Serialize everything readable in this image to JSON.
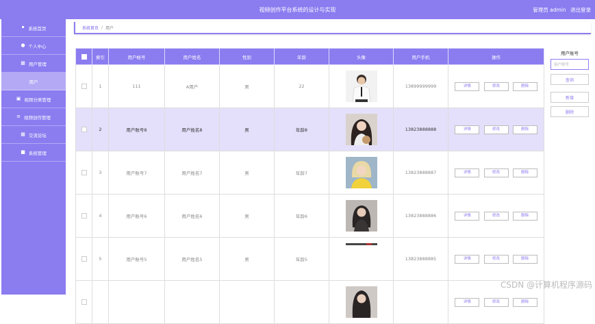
{
  "header": {
    "title": "视频创作平台系统的设计与实现",
    "user_label": "管理员 admin",
    "logout": "退出登录"
  },
  "sidebar": {
    "items": [
      {
        "label": "系统首页",
        "icon": "home-icon"
      },
      {
        "label": "个人中心",
        "icon": "user-icon"
      },
      {
        "label": "用户管理",
        "icon": "table-icon"
      },
      {
        "label": "用户",
        "icon": ""
      },
      {
        "label": "视频分类管理",
        "icon": "category-icon"
      },
      {
        "label": "视频创作管理",
        "icon": "sliders-icon"
      },
      {
        "label": "交流论坛",
        "icon": "grid-icon"
      },
      {
        "label": "系统管理",
        "icon": "settings-icon"
      }
    ]
  },
  "breadcrumb": {
    "home": "系统首页",
    "separator": "/",
    "current": "用户"
  },
  "table": {
    "headers": [
      "索引",
      "用户帐号",
      "用户姓名",
      "性别",
      "年龄",
      "头像",
      "用户手机",
      "操作"
    ],
    "rows": [
      {
        "index": "1",
        "account": "111",
        "name": "A用户",
        "gender": "男",
        "age": "22",
        "phone": "13899999999"
      },
      {
        "index": "2",
        "account": "用户账号8",
        "name": "用户姓名8",
        "gender": "男",
        "age": "年龄8",
        "phone": "13823888888"
      },
      {
        "index": "3",
        "account": "用户账号7",
        "name": "用户姓名7",
        "gender": "男",
        "age": "年龄7",
        "phone": "13823888887"
      },
      {
        "index": "4",
        "account": "用户账号6",
        "name": "用户姓名6",
        "gender": "男",
        "age": "年龄6",
        "phone": "13823888886"
      },
      {
        "index": "5",
        "account": "用户账号5",
        "name": "用户姓名5",
        "gender": "男",
        "age": "年龄5",
        "phone": "13823888885"
      },
      {
        "index": "",
        "account": "",
        "name": "",
        "gender": "",
        "age": "",
        "phone": ""
      }
    ],
    "actions": {
      "detail": "详情",
      "edit": "修改",
      "delete": "删除"
    }
  },
  "search_panel": {
    "label": "用户账号",
    "placeholder": "用户账号",
    "query_button": "查询",
    "add_button": "新增",
    "delete_button": "删除"
  },
  "watermark": "CSDN @计算机程序源码",
  "colors": {
    "accent": "#8b7cf0",
    "highlight_row": "#e4e0fb"
  }
}
